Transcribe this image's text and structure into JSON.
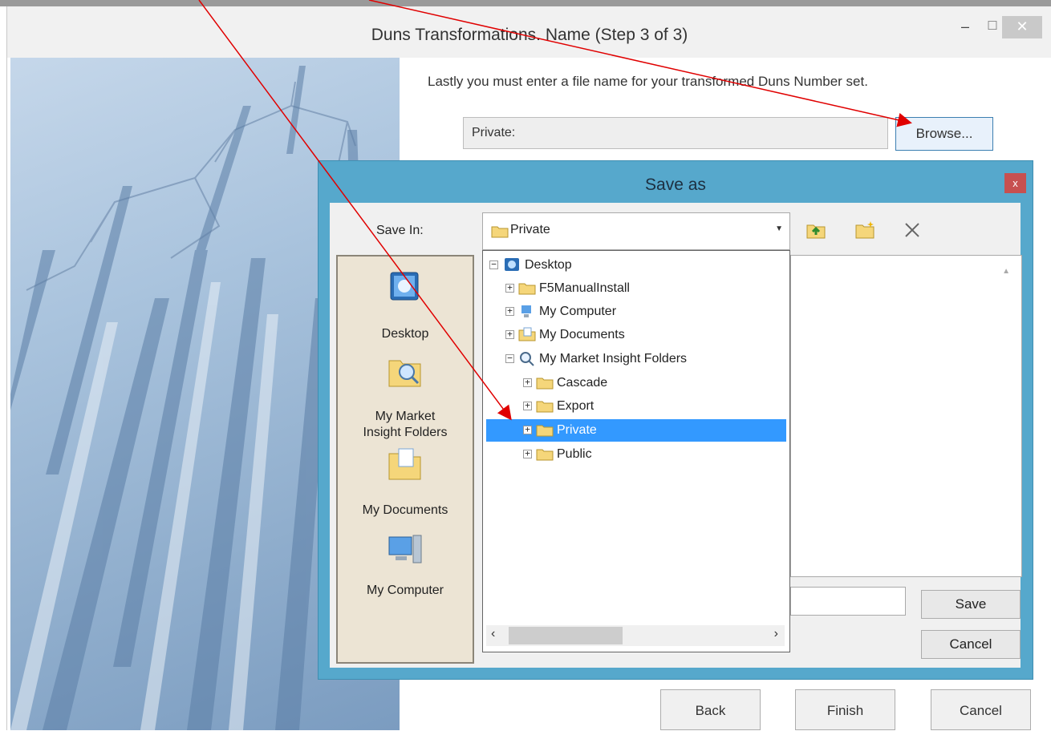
{
  "wizard": {
    "title": "Duns Transformations.  Name (Step 3 of 3)",
    "description": "Lastly you must enter a file name for your transformed Duns Number set.",
    "path_value": "Private:",
    "browse_label": "Browse...",
    "back_label": "Back",
    "finish_label": "Finish",
    "cancel_label": "Cancel",
    "window_buttons": {
      "minimize": "–",
      "maximize": "☐",
      "close": "✕"
    }
  },
  "dialog": {
    "title": "Save as",
    "close_glyph": "x",
    "save_in_label": "Save In:",
    "save_in_value": "Private",
    "toolbar_icons": [
      "folder-up-icon",
      "new-folder-icon",
      "delete-icon"
    ],
    "places": [
      {
        "label": "Desktop",
        "icon": "desktop-icon"
      },
      {
        "label": "My Market\nInsight Folders",
        "icon": "market-insight-icon"
      },
      {
        "label": "My Documents",
        "icon": "documents-icon"
      },
      {
        "label": "My Computer",
        "icon": "computer-icon"
      }
    ],
    "tree": [
      {
        "label": "Desktop",
        "expander": "−",
        "icon": "desktop-globe-icon"
      },
      {
        "label": "F5ManualInstall",
        "expander": "+",
        "icon": "folder-icon"
      },
      {
        "label": "My Computer",
        "expander": "+",
        "icon": "computer-icon"
      },
      {
        "label": "My Documents",
        "expander": "+",
        "icon": "documents-icon"
      },
      {
        "label": "My Market Insight Folders",
        "expander": "−",
        "icon": "magnifier-icon"
      },
      {
        "label": "Cascade",
        "expander": "+",
        "icon": "folder-icon"
      },
      {
        "label": "Export",
        "expander": "+",
        "icon": "folder-icon"
      },
      {
        "label": "Private",
        "expander": "+",
        "icon": "folder-icon",
        "selected": true
      },
      {
        "label": "Public",
        "expander": "+",
        "icon": "folder-icon"
      }
    ],
    "save_label": "Save",
    "cancel_label": "Cancel",
    "file_name_value": ""
  },
  "colors": {
    "dialog_frame": "#56a8cc",
    "selection": "#3399ff",
    "annotation_arrow": "#e00000",
    "close_button": "#c75050"
  }
}
